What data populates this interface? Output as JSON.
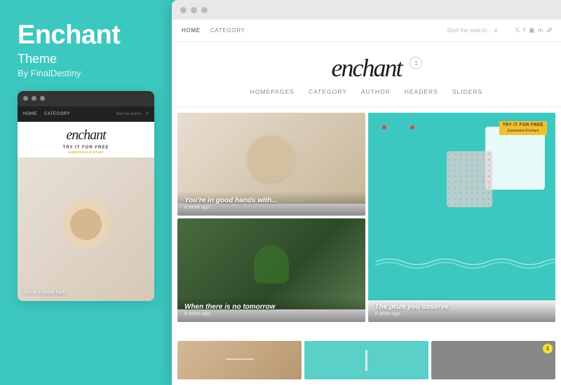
{
  "left": {
    "title": "Enchant",
    "subtitle": "Theme",
    "author": "By FinalDestiny"
  },
  "mini_preview": {
    "nav_items": [
      "HOME",
      "CATEGORY"
    ],
    "search_placeholder": "Start the search...",
    "logo": "enchant",
    "try_label": "TRY IT FOR FREE",
    "experience_label": "Experience Enchant",
    "image_caption": "You're in good han..."
  },
  "browser": {
    "nav_items": [
      "HOME",
      "CATEGORY"
    ],
    "search_placeholder": "Start the search...",
    "social_icons": [
      "twitter",
      "facebook",
      "instagram",
      "linkedin",
      "pinterest"
    ],
    "logo": "enchant",
    "badge": "1",
    "subnav_items": [
      "HOMEPAGES",
      "CATEGORY",
      "AUTHOR",
      "HEADERS",
      "SLIDERS"
    ]
  },
  "grid_items": [
    {
      "caption": "You're in good hands with...",
      "time": "a week ago",
      "type": "honey"
    },
    {
      "caption": "The prize you deserve",
      "time": "8 years ago",
      "type": "teal",
      "badge_top": "TRY IT FOR FREE",
      "badge_sub": "Experience Enchant"
    },
    {
      "caption": "When there is no tomorrow",
      "time": "8 years ago",
      "type": "plants"
    }
  ],
  "bottom_items": [
    {
      "type": "wood",
      "has_badge": false
    },
    {
      "type": "teal",
      "has_badge": false
    },
    {
      "type": "dark",
      "has_badge": true,
      "badge_label": "1"
    }
  ],
  "colors": {
    "teal": "#3cc8c0",
    "dark": "#222",
    "accent": "#f0c030"
  }
}
